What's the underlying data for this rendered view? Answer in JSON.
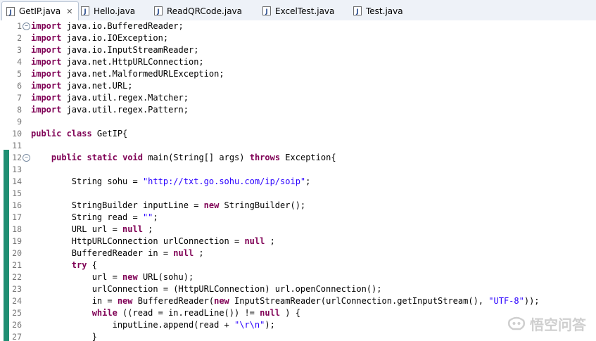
{
  "tabs": [
    {
      "label": "GetIP.java",
      "active": true,
      "close": "✕"
    },
    {
      "label": "Hello.java"
    },
    {
      "label": "ReadQRCode.java"
    },
    {
      "label": "ExcelTest.java"
    },
    {
      "label": "Test.java"
    }
  ],
  "lines": [
    {
      "n": "1",
      "fold": "⊖",
      "segs": [
        [
          "kw",
          "import"
        ],
        [
          "",
          "java.io.BufferedReader;"
        ]
      ]
    },
    {
      "n": "2",
      "segs": [
        [
          "kw",
          "import"
        ],
        [
          "",
          "java.io.IOException;"
        ]
      ]
    },
    {
      "n": "3",
      "segs": [
        [
          "kw",
          "import"
        ],
        [
          "",
          "java.io.InputStreamReader;"
        ]
      ]
    },
    {
      "n": "4",
      "segs": [
        [
          "kw",
          "import"
        ],
        [
          "",
          "java.net.HttpURLConnection;"
        ]
      ]
    },
    {
      "n": "5",
      "segs": [
        [
          "kw",
          "import"
        ],
        [
          "",
          "java.net.MalformedURLException;"
        ]
      ]
    },
    {
      "n": "6",
      "segs": [
        [
          "kw",
          "import"
        ],
        [
          "",
          "java.net.URL;"
        ]
      ]
    },
    {
      "n": "7",
      "segs": [
        [
          "kw",
          "import"
        ],
        [
          "",
          "java.util.regex.Matcher;"
        ]
      ]
    },
    {
      "n": "8",
      "segs": [
        [
          "kw",
          "import"
        ],
        [
          "",
          "java.util.regex.Pattern;"
        ]
      ]
    },
    {
      "n": "9",
      "segs": []
    },
    {
      "n": "10",
      "segs": [
        [
          "kw",
          "public"
        ],
        [
          "",
          ""
        ],
        [
          "kw",
          "class"
        ],
        [
          "",
          " GetIP{"
        ]
      ]
    },
    {
      "n": "11",
      "segs": []
    },
    {
      "n": "12",
      "fold": "⊖",
      "segs": [
        [
          "",
          "    "
        ],
        [
          "kw",
          "public"
        ],
        [
          "",
          " "
        ],
        [
          "kw",
          "static"
        ],
        [
          "",
          " "
        ],
        [
          "kw",
          "void"
        ],
        [
          "",
          " main(String[] args) "
        ],
        [
          "kw",
          "throws"
        ],
        [
          "",
          " Exception{"
        ]
      ]
    },
    {
      "n": "13",
      "segs": []
    },
    {
      "n": "14",
      "segs": [
        [
          "",
          "        String sohu = "
        ],
        [
          "str",
          "\"http://txt.go.sohu.com/ip/soip\""
        ],
        [
          "",
          ";"
        ]
      ]
    },
    {
      "n": "15",
      "segs": []
    },
    {
      "n": "16",
      "segs": [
        [
          "",
          "        StringBuilder inputLine = "
        ],
        [
          "kw",
          "new"
        ],
        [
          "",
          " StringBuilder();"
        ]
      ]
    },
    {
      "n": "17",
      "segs": [
        [
          "",
          "        String read = "
        ],
        [
          "str",
          "\"\""
        ],
        [
          "",
          ";"
        ]
      ]
    },
    {
      "n": "18",
      "segs": [
        [
          "",
          "        URL url = "
        ],
        [
          "kw",
          "null"
        ],
        [
          "",
          ";"
        ]
      ]
    },
    {
      "n": "19",
      "segs": [
        [
          "",
          "        HttpURLConnection urlConnection = "
        ],
        [
          "kw",
          "null"
        ],
        [
          "",
          ";"
        ]
      ]
    },
    {
      "n": "20",
      "segs": [
        [
          "",
          "        BufferedReader in = "
        ],
        [
          "kw",
          "null"
        ],
        [
          "",
          ";"
        ]
      ]
    },
    {
      "n": "21",
      "segs": [
        [
          "",
          "        "
        ],
        [
          "kw",
          "try"
        ],
        [
          "",
          " {"
        ]
      ]
    },
    {
      "n": "22",
      "segs": [
        [
          "",
          "            url = "
        ],
        [
          "kw",
          "new"
        ],
        [
          "",
          " URL(sohu);"
        ]
      ]
    },
    {
      "n": "23",
      "segs": [
        [
          "",
          "            urlConnection = (HttpURLConnection) url.openConnection();"
        ]
      ]
    },
    {
      "n": "24",
      "segs": [
        [
          "",
          "            in = "
        ],
        [
          "kw",
          "new"
        ],
        [
          "",
          " BufferedReader("
        ],
        [
          "kw",
          "new"
        ],
        [
          "",
          " InputStreamReader(urlConnection.getInputStream(), "
        ],
        [
          "str",
          "\"UTF-8\""
        ],
        [
          "",
          "));"
        ]
      ]
    },
    {
      "n": "25",
      "segs": [
        [
          "",
          "            "
        ],
        [
          "kw",
          "while"
        ],
        [
          "",
          " ((read = in.readLine()) != "
        ],
        [
          "kw",
          "null"
        ],
        [
          "",
          ") {"
        ]
      ]
    },
    {
      "n": "26",
      "segs": [
        [
          "",
          "                inputLine.append(read + "
        ],
        [
          "str",
          "\"\\r\\n\""
        ],
        [
          "",
          ");"
        ]
      ]
    },
    {
      "n": "27",
      "segs": [
        [
          "",
          "            }"
        ]
      ]
    }
  ],
  "watermark": {
    "text": "悟空问答"
  },
  "colors": {
    "keyword": "#7f0055",
    "string": "#2a00ff",
    "marker": "#1f8f73"
  }
}
